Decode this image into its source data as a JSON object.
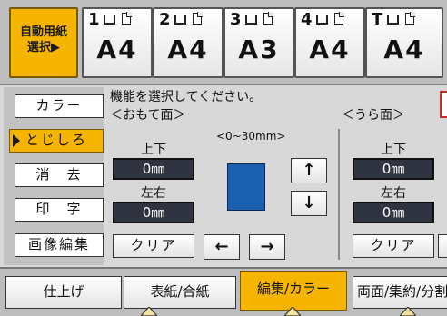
{
  "trays": {
    "auto_select_line1": "自動用紙",
    "auto_select_line2": "選択▶",
    "items": [
      {
        "num": "1",
        "size": "A4"
      },
      {
        "num": "2",
        "size": "A4"
      },
      {
        "num": "3",
        "size": "A3"
      },
      {
        "num": "4",
        "size": "A4"
      },
      {
        "num": "T",
        "size": "A4"
      }
    ]
  },
  "side_menu": {
    "color": "カラー",
    "binding": "とじしろ",
    "erase": "消　去",
    "stamp": "印　字",
    "image_edit": "画像編集"
  },
  "main": {
    "instruction": "機能を選択してください。",
    "front_label": "＜おもて面＞",
    "back_label": "＜うら面＞",
    "range": "<0~30mm>",
    "front": {
      "tb_label": "上下",
      "tb_value": "0㎜",
      "lr_label": "左右",
      "lr_value": "0㎜",
      "clear": "クリア"
    },
    "back": {
      "tb_label": "上下",
      "tb_value": "0㎜",
      "lr_label": "左右",
      "lr_value": "0㎜",
      "clear": "クリア"
    },
    "arrows": {
      "up": "↑",
      "down": "↓",
      "left": "←",
      "right": "→"
    }
  },
  "tabs": {
    "finishing": "仕上げ",
    "cover": "表紙/合紙",
    "edit_color": "編集/カラー",
    "duplex": "両面/集約/分割"
  },
  "colors": {
    "accent": "#f5b400",
    "value_box": "#2f3440",
    "paper_preview": "#1a5fb0"
  }
}
